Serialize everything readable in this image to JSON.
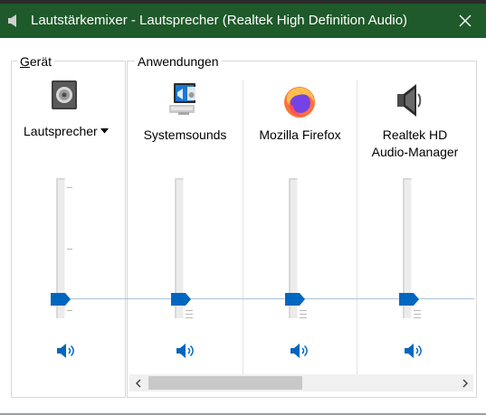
{
  "window": {
    "title": "Lautstärkemixer - Lautsprecher (Realtek High Definition Audio)"
  },
  "colors": {
    "titlebar": "#1f5a2a",
    "accent": "#0067c0"
  },
  "device_group": {
    "label_hotkey": "G",
    "label_rest": "erät",
    "device": {
      "name": "Lautsprecher",
      "icon": "speaker-box-icon",
      "volume_percent": 12,
      "muted": false
    }
  },
  "apps_group": {
    "label": "Anwendungen",
    "apps": [
      {
        "name": "Systemsounds",
        "icon": "system-sounds-icon",
        "volume_percent": 12,
        "muted": false
      },
      {
        "name": "Mozilla Firefox",
        "icon": "firefox-icon",
        "volume_percent": 12,
        "muted": false
      },
      {
        "name": "Realtek HD Audio-Manager",
        "name_line1": "Realtek HD",
        "name_line2": "Audio-Manager",
        "icon": "loudspeaker-icon",
        "volume_percent": 12,
        "muted": false
      }
    ]
  }
}
